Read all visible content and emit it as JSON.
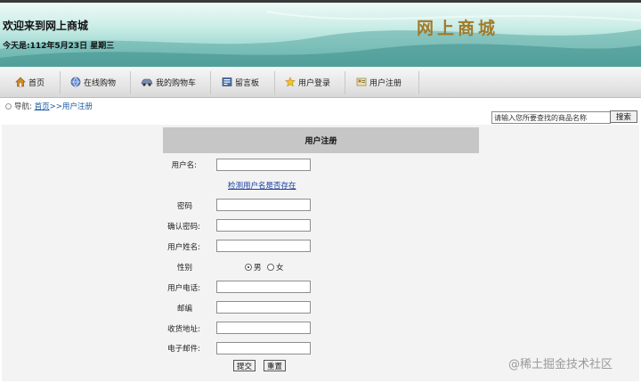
{
  "header": {
    "welcome": "欢迎来到网上商城",
    "today": "今天是:112年5月23日 星期三",
    "site_title": "网上商城"
  },
  "nav": {
    "items": [
      {
        "label": "首页",
        "icon": "home-icon"
      },
      {
        "label": "在线购物",
        "icon": "globe-icon"
      },
      {
        "label": "我的购物车",
        "icon": "car-icon"
      },
      {
        "label": "留言板",
        "icon": "board-icon"
      },
      {
        "label": "用户登录",
        "icon": "star-icon"
      },
      {
        "label": "用户注册",
        "icon": "register-icon"
      }
    ]
  },
  "breadcrumb": {
    "prefix": "导航:",
    "home": "首页",
    "separator": ">>",
    "current": "用户注册"
  },
  "search": {
    "value": "请输入您所要查找的商品名称",
    "button": "搜索"
  },
  "form": {
    "title": "用户注册",
    "username_label": "用户名:",
    "check_link": "检测用户名是否存在",
    "password_label": "密码",
    "confirm_label": "确认密码:",
    "realname_label": "用户姓名:",
    "gender_label": "性别",
    "gender_male": "男",
    "gender_female": "女",
    "gender_selected": "男",
    "phone_label": "用户电话:",
    "zip_label": "邮编",
    "address_label": "收货地址:",
    "email_label": "电子邮件:",
    "submit": "提交",
    "reset": "重置"
  },
  "watermark": "@稀土掘金技术社区"
}
